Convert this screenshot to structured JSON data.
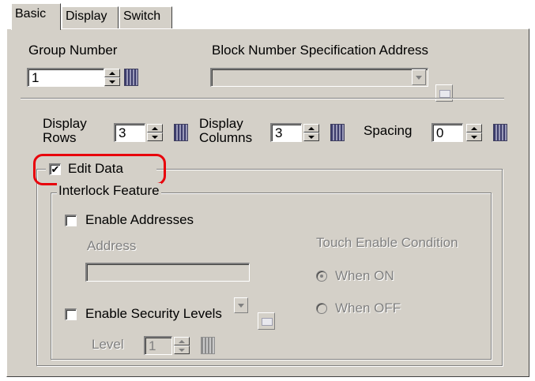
{
  "tabs": [
    {
      "label": "Basic",
      "active": true
    },
    {
      "label": "Display",
      "active": false
    },
    {
      "label": "Switch",
      "active": false
    }
  ],
  "group_number": {
    "label": "Group Number",
    "value": "1"
  },
  "block_number": {
    "label": "Block Number Specification Address",
    "value": ""
  },
  "display_rows": {
    "label_line1": "Display",
    "label_line2": "Rows",
    "value": "3"
  },
  "display_columns": {
    "label_line1": "Display",
    "label_line2": "Columns",
    "value": "3"
  },
  "spacing": {
    "label": "Spacing",
    "value": "0"
  },
  "edit_data": {
    "label": "Edit Data",
    "checked": true
  },
  "interlock": {
    "legend": "Interlock Feature",
    "enable_addresses": {
      "label": "Enable Addresses",
      "checked": false
    },
    "address_label": "Address",
    "address_value": "",
    "touch_condition": {
      "label": "Touch Enable Condition",
      "options": [
        {
          "label": "When ON",
          "selected": true
        },
        {
          "label": "When OFF",
          "selected": false
        }
      ]
    },
    "enable_security": {
      "label": "Enable Security Levels",
      "checked": false
    },
    "level": {
      "label": "Level",
      "value": "1"
    }
  },
  "colors": {
    "dialog_bg": "#d4d0c8",
    "highlight": "#e8000b",
    "disabled_text": "#808080"
  }
}
